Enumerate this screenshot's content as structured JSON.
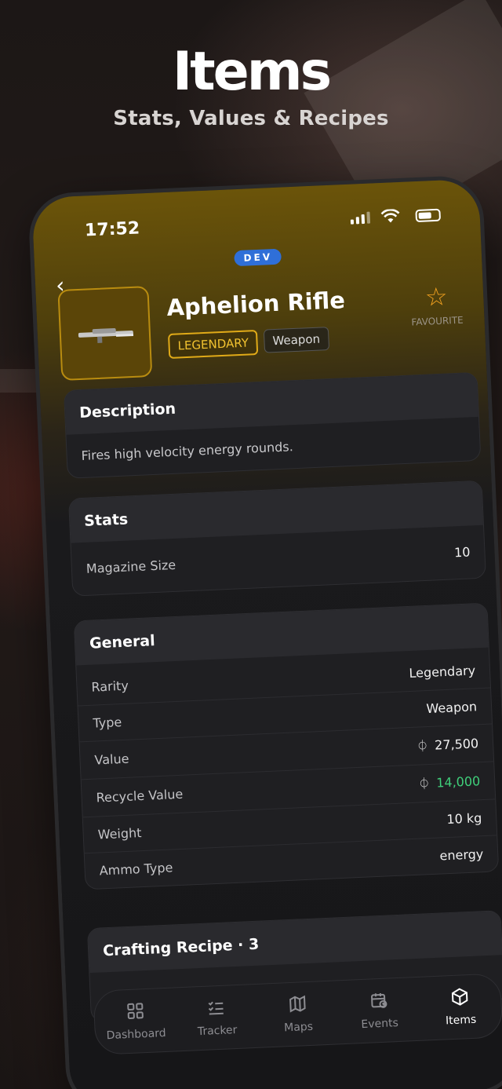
{
  "hero": {
    "title": "Items",
    "subtitle": "Stats, Values & Recipes"
  },
  "status_bar": {
    "time": "17:52"
  },
  "header": {
    "dev_badge": "DEV",
    "item_name": "Aphelion Rifle",
    "rarity_tag": "LEGENDARY",
    "type_tag": "Weapon",
    "favourite_label": "FAVOURITE"
  },
  "description": {
    "title": "Description",
    "text": "Fires high velocity energy rounds."
  },
  "stats": {
    "title": "Stats",
    "rows": [
      {
        "label": "Magazine Size",
        "value": "10"
      }
    ]
  },
  "general": {
    "title": "General",
    "rows": [
      {
        "label": "Rarity",
        "value": "Legendary"
      },
      {
        "label": "Type",
        "value": "Weapon"
      },
      {
        "label": "Value",
        "value": "27,500"
      },
      {
        "label": "Recycle Value",
        "value": "14,000"
      },
      {
        "label": "Weight",
        "value": "10 kg"
      },
      {
        "label": "Ammo Type",
        "value": "energy"
      }
    ]
  },
  "crafting": {
    "title": "Crafting Recipe · 3"
  },
  "tabs": [
    {
      "label": "Dashboard",
      "icon": "grid-icon"
    },
    {
      "label": "Tracker",
      "icon": "checklist-icon"
    },
    {
      "label": "Maps",
      "icon": "map-icon"
    },
    {
      "label": "Events",
      "icon": "calendar-clock-icon"
    },
    {
      "label": "Items",
      "icon": "box-icon"
    }
  ],
  "colors": {
    "accent_gold": "#e0aa18",
    "recycle_green": "#3fcf7a",
    "dev_blue": "#2f6fd8",
    "star_orange": "#f0a020"
  }
}
